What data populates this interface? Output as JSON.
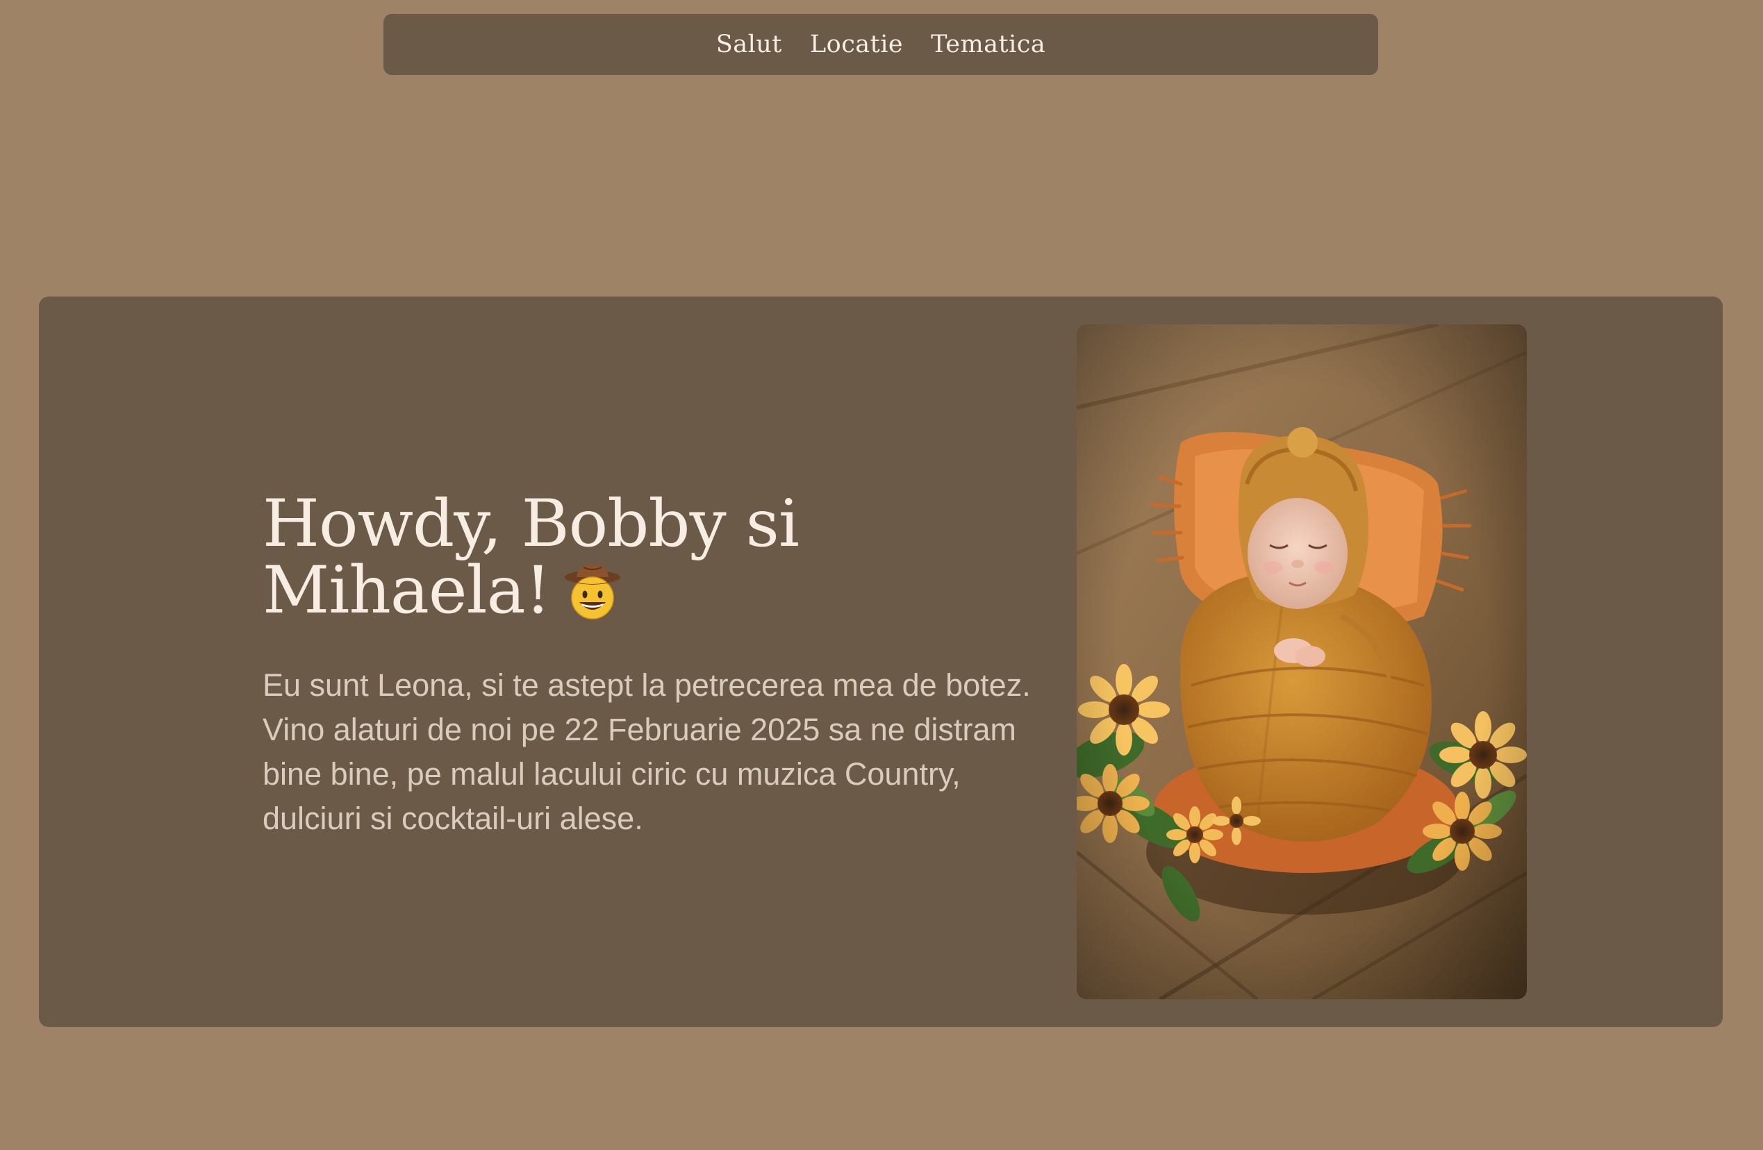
{
  "nav": {
    "items": [
      {
        "label": "Salut"
      },
      {
        "label": "Locatie"
      },
      {
        "label": "Tematica"
      }
    ]
  },
  "hero": {
    "title": "Howdy, Bobby si Mihaela!",
    "emoji_icon": "cowboy-face-icon",
    "body": "Eu sunt Leona, si te astept la petrecerea mea de botez. Vino alaturi de noi pe 22 Februarie 2025 sa ne distram bine bine, pe malul lacului ciric cu muzica Country, dulciuri si cocktail-uri alese.",
    "photo_subject": "newborn-baby-photo"
  },
  "colors": {
    "page_background": "#9e8366",
    "panel": "#6c5a48",
    "title_text": "#f7ede3",
    "body_text": "#d9ccbe"
  }
}
